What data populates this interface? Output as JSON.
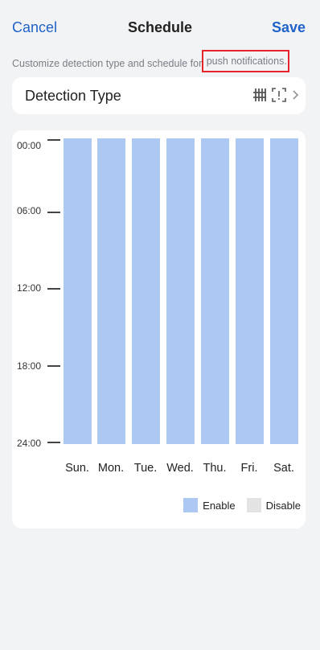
{
  "nav": {
    "cancel_label": "Cancel",
    "title": "Schedule",
    "save_label": "Save"
  },
  "description": {
    "prefix": "Customize detection type and schedule for",
    "highlight": "push notifications."
  },
  "detection": {
    "label": "Detection Type",
    "icons": [
      "motion-grid-icon",
      "person-detect-icon",
      "chevron-right-icon"
    ]
  },
  "schedule": {
    "times": [
      "00:00",
      "06:00",
      "12:00",
      "18:00",
      "24:00"
    ],
    "days": [
      "Sun.",
      "Mon.",
      "Tue.",
      "Wed.",
      "Thu.",
      "Fri.",
      "Sat."
    ],
    "enabled_fraction": [
      1,
      1,
      1,
      1,
      1,
      1,
      1
    ]
  },
  "legend": {
    "enable": "Enable",
    "disable": "Disable"
  },
  "colors": {
    "accent": "#1f62c9",
    "enable": "#aec8f4",
    "disable": "#e3e3e3",
    "highlight_border": "#e6252a"
  }
}
